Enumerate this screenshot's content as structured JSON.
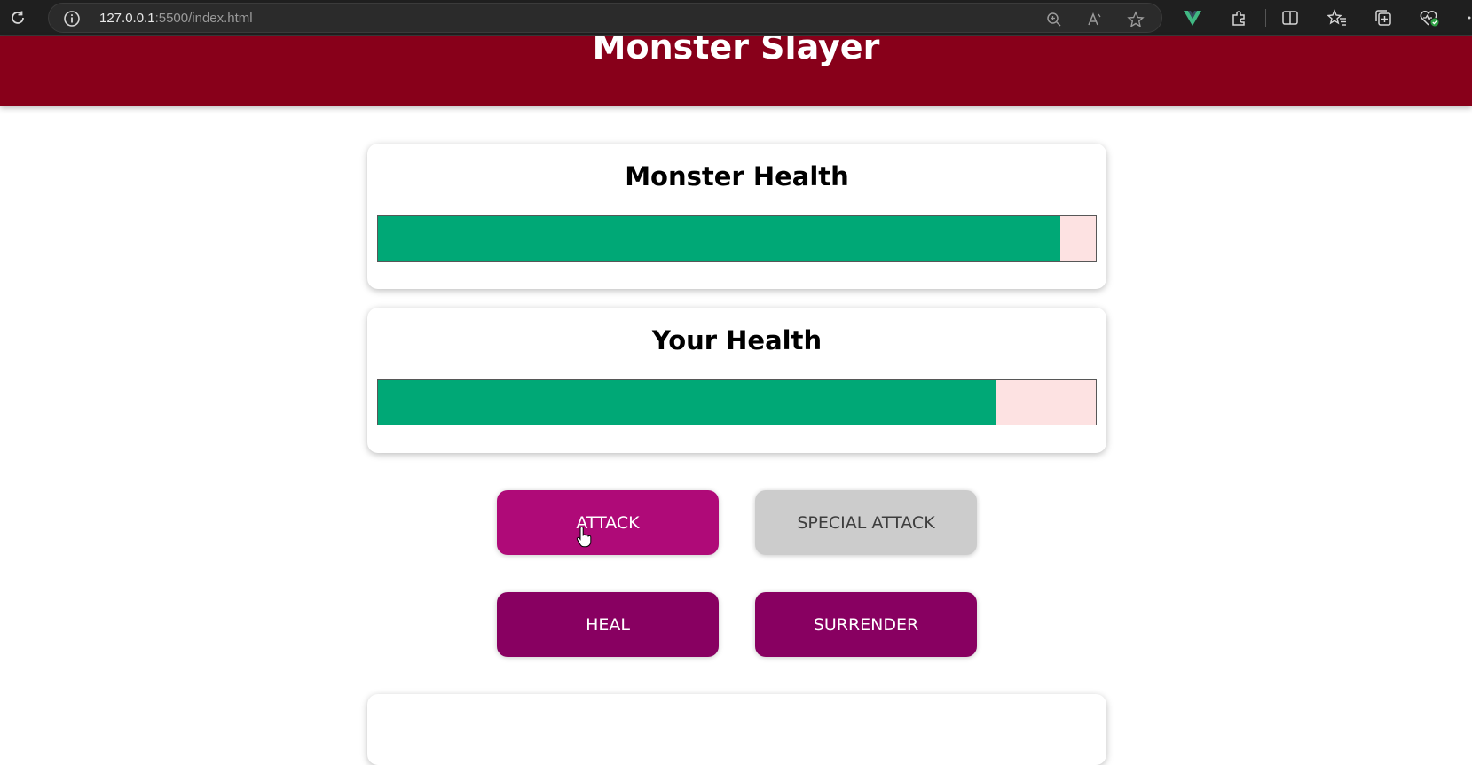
{
  "browser": {
    "url_host": "127.0.0.1",
    "url_path": ":5500/index.html",
    "icons": [
      "reload-icon",
      "info-icon",
      "zoom-icon",
      "read-aloud-icon",
      "favorite-star-icon",
      "vue-devtools-icon",
      "extensions-icon",
      "split-screen-icon",
      "favorites-icon",
      "collections-icon",
      "browser-essentials-icon"
    ]
  },
  "app": {
    "title": "Monster Slayer",
    "header_color": "#88001a"
  },
  "health": {
    "monster": {
      "label": "Monster Health",
      "value_percent": 95
    },
    "player": {
      "label": "Your Health",
      "value_percent": 86
    },
    "fill_color": "#00a876",
    "empty_color": "#fde2e2"
  },
  "controls": {
    "attack": "ATTACK",
    "special_attack": "SPECIAL ATTACK",
    "heal": "HEAL",
    "surrender": "SURRENDER"
  }
}
